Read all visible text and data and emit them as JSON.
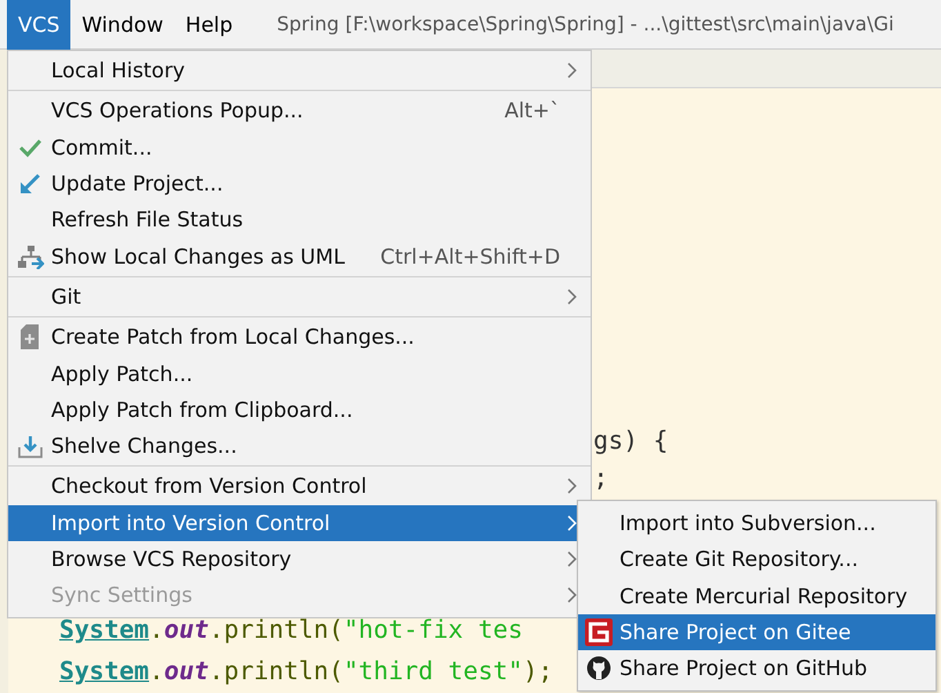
{
  "menubar": {
    "items": [
      {
        "label": "VCS",
        "selected": true
      },
      {
        "label": "Window",
        "selected": false
      },
      {
        "label": "Help",
        "selected": false
      }
    ],
    "title": "Spring [F:\\workspace\\Spring\\Spring] - ...\\gittest\\src\\main\\java\\Gi"
  },
  "editor": {
    "lines": [
      {
        "kind": "fragment",
        "text": "gs) {"
      },
      {
        "kind": "fragment",
        "text": ";"
      },
      {
        "kind": "code",
        "segments": [
          {
            "kind": "object",
            "text": "System"
          },
          {
            "kind": "plain",
            "text": "."
          },
          {
            "kind": "field",
            "text": "out"
          },
          {
            "kind": "plain",
            "text": ".println("
          },
          {
            "kind": "string",
            "text": "\"hot-fix tes"
          }
        ]
      },
      {
        "kind": "code",
        "segments": [
          {
            "kind": "object",
            "text": "System"
          },
          {
            "kind": "plain",
            "text": "."
          },
          {
            "kind": "field",
            "text": "out"
          },
          {
            "kind": "plain",
            "text": ".println("
          },
          {
            "kind": "string",
            "text": "\"third test\""
          },
          {
            "kind": "plain",
            "text": ");"
          }
        ]
      }
    ]
  },
  "vcs_menu": {
    "items": [
      {
        "kind": "item",
        "label": "Local History",
        "submenu": true,
        "selected": false,
        "disabled": false
      },
      {
        "kind": "separator"
      },
      {
        "kind": "item",
        "label": "VCS Operations Popup...",
        "shortcut": "Alt+`",
        "selected": false,
        "disabled": false
      },
      {
        "kind": "item",
        "label": "Commit...",
        "selected": false,
        "disabled": false
      },
      {
        "kind": "item",
        "label": "Update Project...",
        "selected": false,
        "disabled": false
      },
      {
        "kind": "item",
        "label": "Refresh File Status",
        "selected": false,
        "disabled": false
      },
      {
        "kind": "item",
        "label": "Show Local Changes as UML",
        "shortcut": "Ctrl+Alt+Shift+D",
        "selected": false,
        "disabled": false
      },
      {
        "kind": "separator"
      },
      {
        "kind": "item",
        "label": "Git",
        "submenu": true,
        "selected": false,
        "disabled": false
      },
      {
        "kind": "separator"
      },
      {
        "kind": "item",
        "label": "Create Patch from Local Changes...",
        "selected": false,
        "disabled": false
      },
      {
        "kind": "item",
        "label": "Apply Patch...",
        "selected": false,
        "disabled": false
      },
      {
        "kind": "item",
        "label": "Apply Patch from Clipboard...",
        "selected": false,
        "disabled": false
      },
      {
        "kind": "item",
        "label": "Shelve Changes...",
        "selected": false,
        "disabled": false
      },
      {
        "kind": "separator"
      },
      {
        "kind": "item",
        "label": "Checkout from Version Control",
        "submenu": true,
        "selected": false,
        "disabled": false
      },
      {
        "kind": "item",
        "label": "Import into Version Control",
        "submenu": true,
        "selected": true,
        "disabled": false
      },
      {
        "kind": "item",
        "label": "Browse VCS Repository",
        "submenu": true,
        "selected": false,
        "disabled": false
      },
      {
        "kind": "item",
        "label": "Sync Settings",
        "submenu": true,
        "selected": false,
        "disabled": true
      }
    ]
  },
  "import_submenu": {
    "items": [
      {
        "label": "Import into Subversion...",
        "selected": false
      },
      {
        "label": "Create Git Repository...",
        "selected": false
      },
      {
        "label": "Create Mercurial Repository",
        "selected": false
      },
      {
        "label": "Share Project on Gitee",
        "selected": true
      },
      {
        "label": "Share Project on GitHub",
        "selected": false
      }
    ]
  }
}
